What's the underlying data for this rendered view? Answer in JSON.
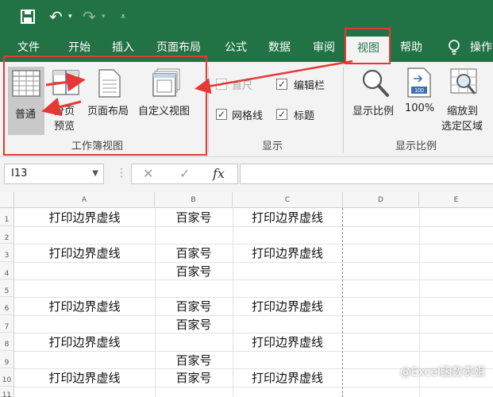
{
  "quick_access": {
    "save_icon": "save-icon",
    "undo_icon": "undo-icon",
    "redo_icon": "redo-icon",
    "customize_icon": "customize-icon"
  },
  "tabs": [
    "文件",
    "开始",
    "插入",
    "页面布局",
    "公式",
    "数据",
    "审阅",
    "视图",
    "帮助",
    "操作"
  ],
  "active_tab": "视图",
  "ribbon": {
    "workbook_views": {
      "group_label": "工作簿视图",
      "normal": "普通",
      "page_break_1": "分页",
      "page_break_2": "预览",
      "page_layout": "页面布局",
      "custom_views": "自定义视图"
    },
    "show": {
      "group_label": "显示",
      "ruler": "直尺",
      "formula_bar": "编辑栏",
      "gridlines": "网格线",
      "headings": "标题"
    },
    "zoom": {
      "group_label": "显示比例",
      "zoom": "显示比例",
      "hundred": "100%",
      "zoom_sel_1": "缩放到",
      "zoom_sel_2": "选定区域"
    }
  },
  "formula_bar": {
    "name_box": "I13",
    "fx": "fx",
    "cancel_icon": "close-icon",
    "enter_icon": "check-icon"
  },
  "columns": [
    "A",
    "B",
    "C",
    "D",
    "E"
  ],
  "rows": [
    {
      "n": "1",
      "a": "打印边界虚线",
      "b": "百家号",
      "c": "打印边界虚线"
    },
    {
      "n": "2",
      "a": "",
      "b": "",
      "c": ""
    },
    {
      "n": "3",
      "a": "打印边界虚线",
      "b": "百家号",
      "c": "打印边界虚线"
    },
    {
      "n": "4",
      "a": "",
      "b": "百家号",
      "c": ""
    },
    {
      "n": "5",
      "a": "",
      "b": "",
      "c": ""
    },
    {
      "n": "6",
      "a": "打印边界虚线",
      "b": "百家号",
      "c": "打印边界虚线"
    },
    {
      "n": "7",
      "a": "",
      "b": "百家号",
      "c": ""
    },
    {
      "n": "8",
      "a": "打印边界虚线",
      "b": "",
      "c": "打印边界虚线"
    },
    {
      "n": "9",
      "a": "",
      "b": "百家号",
      "c": ""
    },
    {
      "n": "10",
      "a": "打印边界虚线",
      "b": "百家号",
      "c": "打印边界虚线"
    },
    {
      "n": "11",
      "a": "",
      "b": "",
      "c": ""
    }
  ],
  "watermark": "@Excel函数表姐",
  "colors": {
    "brand": "#217346",
    "annotation": "#e53935"
  }
}
